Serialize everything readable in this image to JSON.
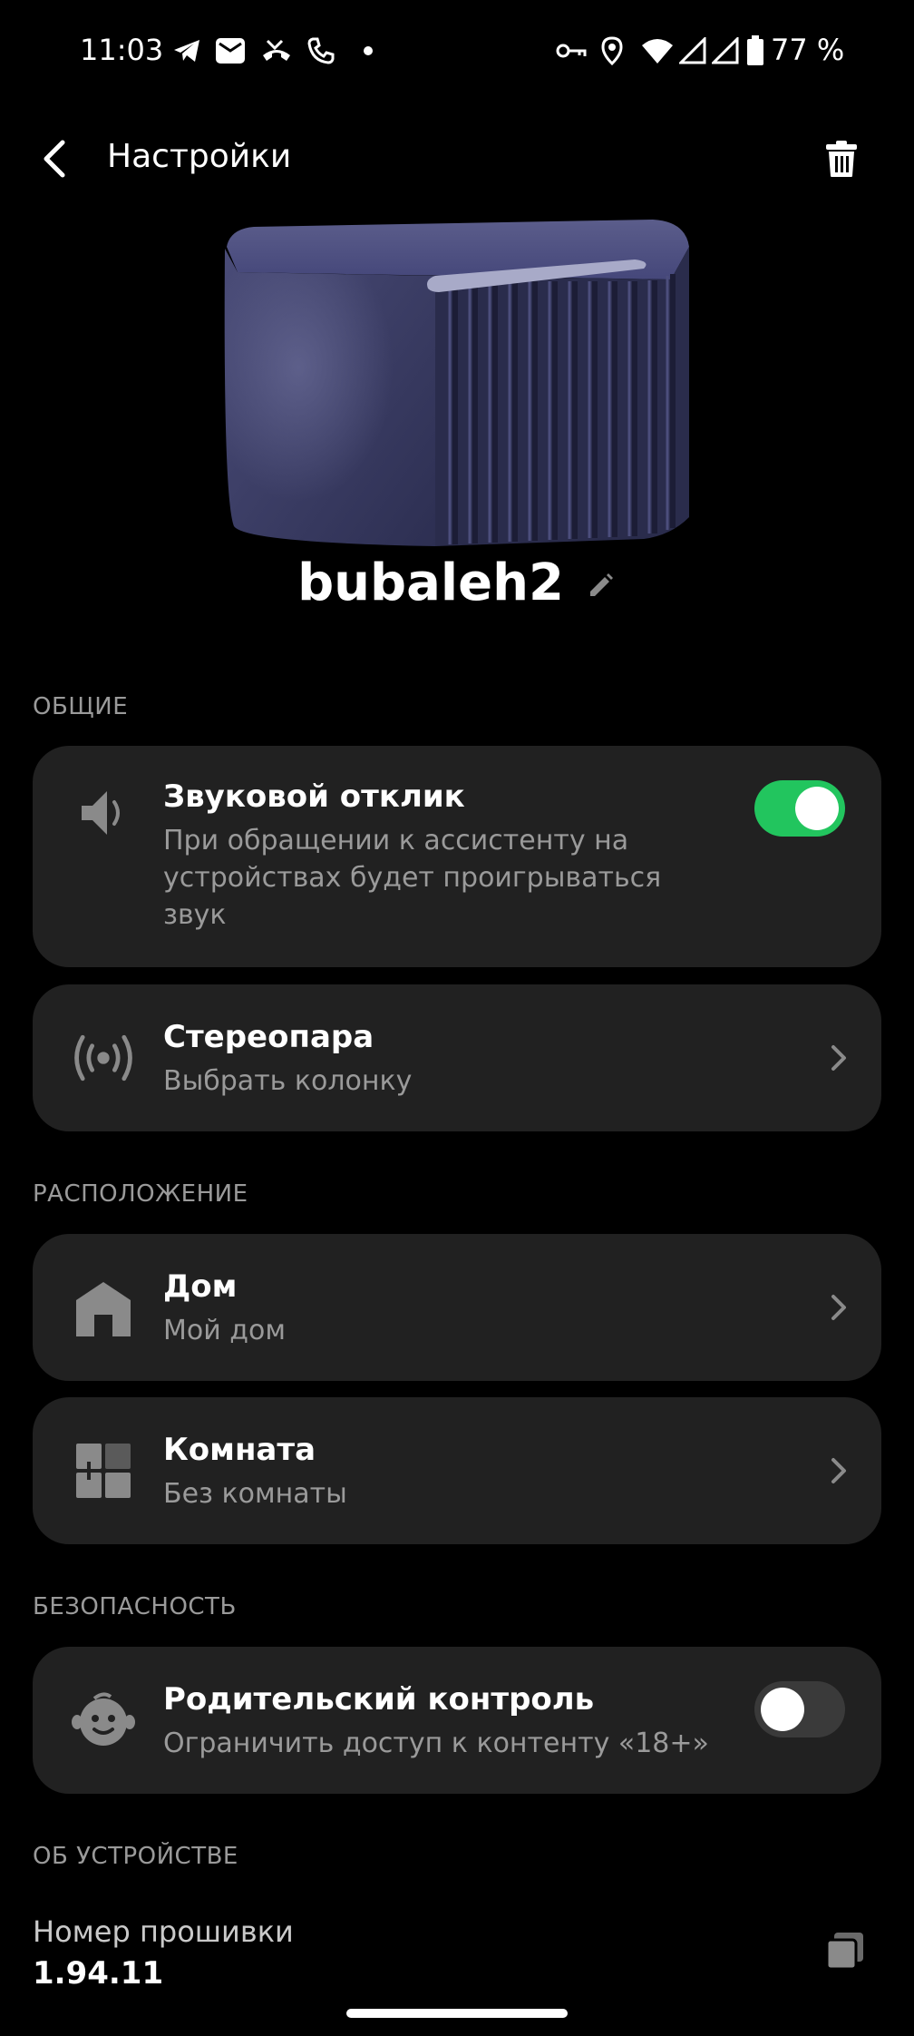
{
  "status_bar": {
    "time": "11:03",
    "battery": "77 %",
    "left_icons": [
      "telegram-icon",
      "mail-icon",
      "missed-call-icon",
      "phone-icon",
      "dot-icon"
    ],
    "right_icons": [
      "key-icon",
      "location-icon",
      "wifi-icon",
      "signal-icon",
      "signal-icon",
      "battery-icon"
    ]
  },
  "header": {
    "title": "Настройки"
  },
  "device": {
    "name": "bubaleh2",
    "color": "#3b3d63"
  },
  "sections": {
    "general": "ОБЩИЕ",
    "location": "РАСПОЛОЖЕНИЕ",
    "security": "БЕЗОПАСНОСТЬ",
    "about": "ОБ УСТРОЙСТВЕ"
  },
  "sound_feedback": {
    "title": "Звуковой отклик",
    "subtitle_lines": [
      "При обращении к ассистенту на",
      "устройствах будет проигрываться",
      "звук"
    ],
    "enabled": true
  },
  "stereo_pair": {
    "title": "Стереопара",
    "subtitle": "Выбрать колонку"
  },
  "home": {
    "title": "Дом",
    "subtitle": "Мой дом"
  },
  "room": {
    "title": "Комната",
    "subtitle": "Без комнаты"
  },
  "parental_control": {
    "title": "Родительский контроль",
    "subtitle": "Ограничить доступ к контенту «18+»",
    "enabled": false
  },
  "firmware": {
    "label": "Номер прошивки",
    "value": "1.94.11"
  },
  "colors": {
    "background": "#000000",
    "card": "#212121",
    "toggle_on": "#22c55e",
    "secondary_text": "#9a9a9a"
  }
}
